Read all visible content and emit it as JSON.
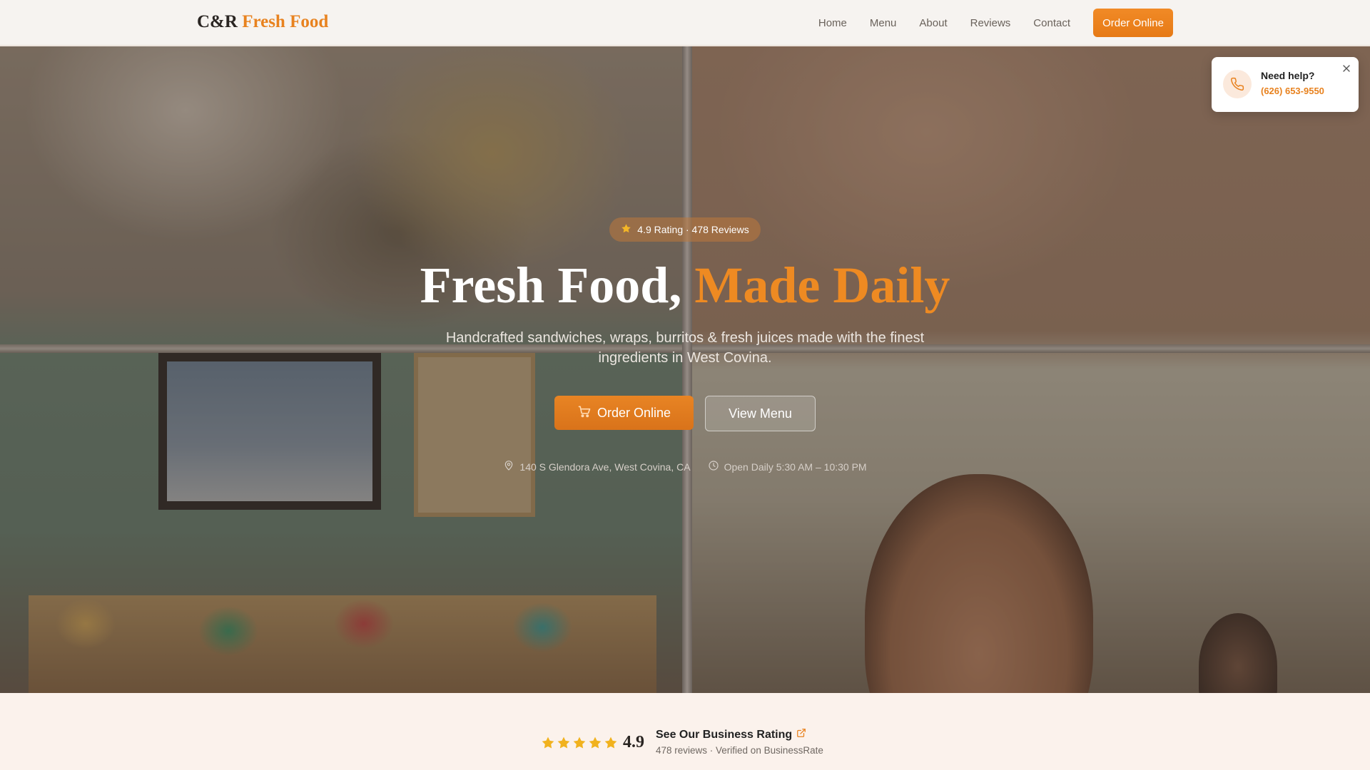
{
  "colors": {
    "accent": "#e8821f",
    "star": "#f1b21e",
    "nav_bg": "#f6f3f0",
    "page_bg": "#fbf2ec"
  },
  "brand": {
    "name": "C&R",
    "accent": "Fresh Food"
  },
  "nav": {
    "links": [
      "Home",
      "Menu",
      "About",
      "Reviews",
      "Contact"
    ],
    "cta": "Order Online"
  },
  "hero": {
    "rating_badge": {
      "icon": "star-icon",
      "text": "4.9 Rating · 478 Reviews"
    },
    "title": "Fresh Food,",
    "title_accent": "Made Daily",
    "subtitle": "Handcrafted sandwiches, wraps, burritos & fresh juices made with the finest ingredients in West Covina.",
    "primary_button": {
      "icon": "cart-icon",
      "label": "Order Online"
    },
    "secondary_button": {
      "label": "View Menu"
    },
    "info": {
      "address": "140 S Glendora Ave, West Covina, CA",
      "address_icon": "map-pin-icon",
      "hours": "Open Daily 5:30 AM – 10:30 PM",
      "hours_icon": "clock-icon"
    }
  },
  "help_popup": {
    "icon": "phone-icon",
    "title": "Need help?",
    "phone": "(626) 653-9550",
    "close_icon": "close-icon"
  },
  "rating_strip": {
    "stars": 5,
    "score": "4.9",
    "title": "See Our Business Rating",
    "title_icon": "external-link-icon",
    "subtitle": "478 reviews · Verified on BusinessRate"
  }
}
